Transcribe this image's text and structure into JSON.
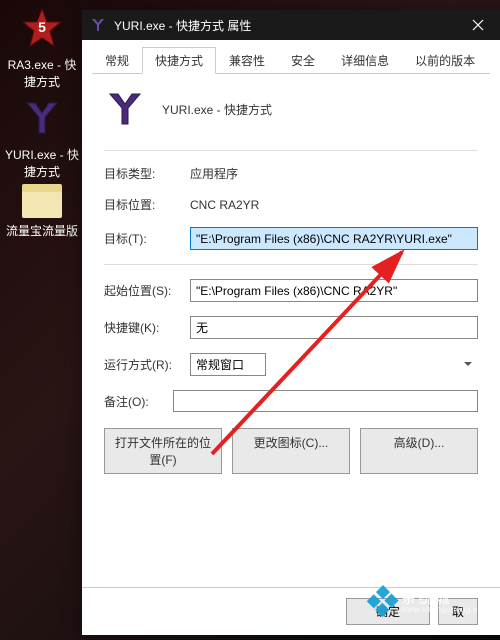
{
  "desktop": {
    "icons": [
      {
        "label": "RA3.exe - 快捷方式"
      },
      {
        "label": "YURI.exe - 快捷方式"
      },
      {
        "label": "流量宝流量版"
      }
    ]
  },
  "window": {
    "title": "YURI.exe - 快捷方式 属性",
    "tabs": [
      "常规",
      "快捷方式",
      "兼容性",
      "安全",
      "详细信息",
      "以前的版本"
    ],
    "active_tab": 1,
    "header_name": "YURI.exe - 快捷方式",
    "fields": {
      "target_type_label": "目标类型:",
      "target_type_value": "应用程序",
      "target_loc_label": "目标位置:",
      "target_loc_value": "CNC RA2YR",
      "target_label": "目标(T):",
      "target_value": "\"E:\\Program Files (x86)\\CNC RA2YR\\YURI.exe\"",
      "startin_label": "起始位置(S):",
      "startin_value": "\"E:\\Program Files (x86)\\CNC RA2YR\"",
      "hotkey_label": "快捷键(K):",
      "hotkey_value": "无",
      "run_label": "运行方式(R):",
      "run_value": "常规窗口",
      "comment_label": "备注(O):",
      "comment_value": ""
    },
    "buttons": {
      "open_location": "打开文件所在的位置(F)",
      "change_icon": "更改图标(C)...",
      "advanced": "高级(D)..."
    },
    "bottom": {
      "ok": "确定",
      "cancel": "取"
    }
  },
  "watermark": {
    "brand": "系统城",
    "url": "www.xitongcheng.com"
  }
}
